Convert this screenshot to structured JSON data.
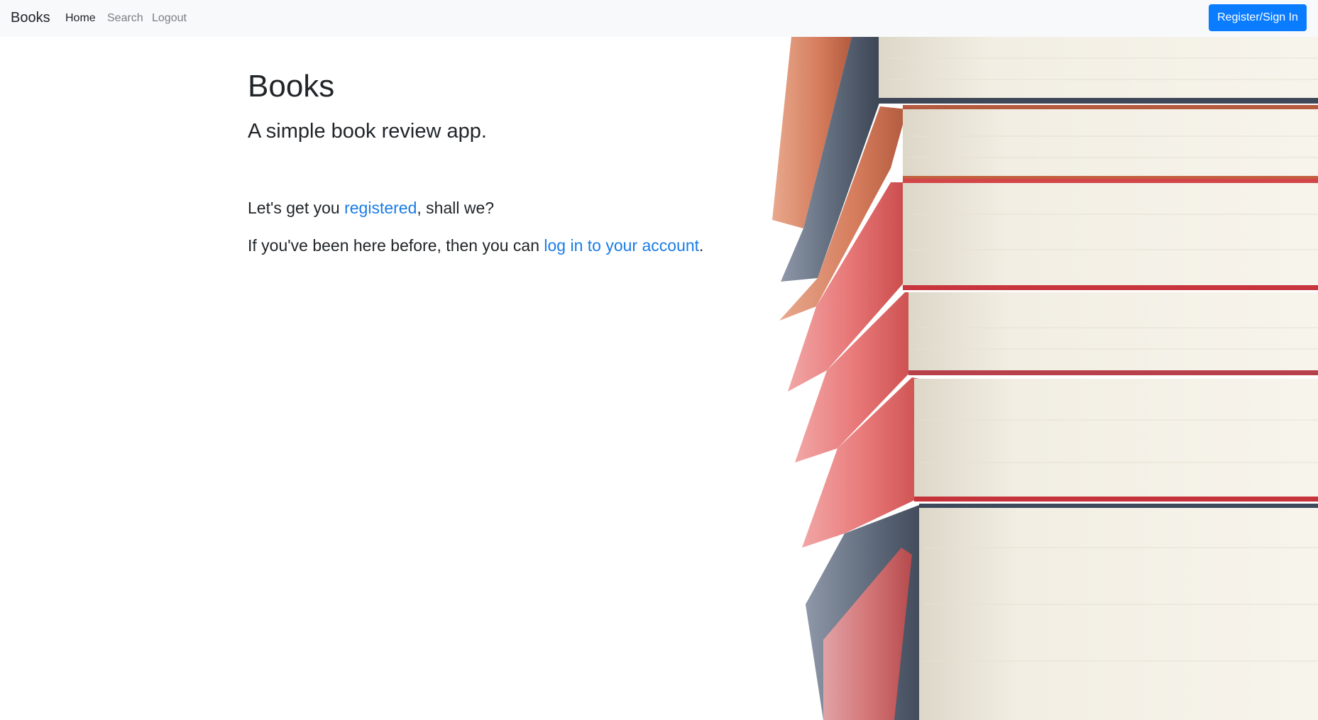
{
  "navbar": {
    "brand": "Books",
    "links": [
      "Home",
      "Search",
      "Logout"
    ],
    "button": "Register/Sign In"
  },
  "main": {
    "title": "Books",
    "subtitle": "A simple book review app.",
    "register_line": {
      "before": "Let's get you ",
      "link": "registered",
      "after": ", shall we?"
    },
    "login_line": {
      "before": "If you've been here before, then you can ",
      "link": "log in to your account",
      "after": "."
    }
  },
  "colors": {
    "navbar_bg": "#f8f9fa",
    "primary": "#0a7cff",
    "link": "#1a7ce6"
  }
}
